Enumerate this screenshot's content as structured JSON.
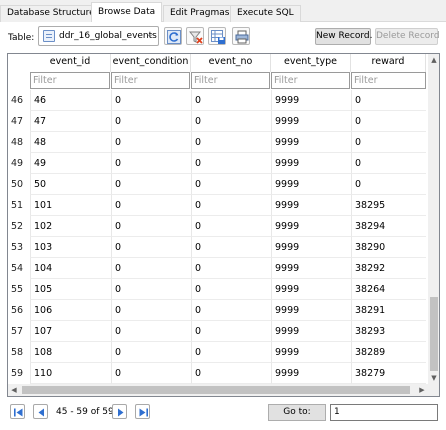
{
  "tabs": [
    {
      "label": "Database Structure",
      "active": false
    },
    {
      "label": "Browse Data",
      "active": true
    },
    {
      "label": "Edit Pragmas",
      "active": false
    },
    {
      "label": "Execute SQL",
      "active": false
    }
  ],
  "toolbar": {
    "table_label": "Table:",
    "table_selected": "ddr_16_global_events",
    "new_record_label": "New Record.",
    "delete_record_label": "Delete Record"
  },
  "grid": {
    "columns": [
      "event_id",
      "event_condition",
      "event_no",
      "event_type",
      "reward"
    ],
    "filter_placeholder": "Filter",
    "rows": [
      {
        "num": "46",
        "cells": [
          "46",
          "0",
          "0",
          "9999",
          "0"
        ]
      },
      {
        "num": "47",
        "cells": [
          "47",
          "0",
          "0",
          "9999",
          "0"
        ]
      },
      {
        "num": "48",
        "cells": [
          "48",
          "0",
          "0",
          "9999",
          "0"
        ]
      },
      {
        "num": "49",
        "cells": [
          "49",
          "0",
          "0",
          "9999",
          "0"
        ]
      },
      {
        "num": "50",
        "cells": [
          "50",
          "0",
          "0",
          "9999",
          "0"
        ]
      },
      {
        "num": "51",
        "cells": [
          "101",
          "0",
          "0",
          "9999",
          "38295"
        ]
      },
      {
        "num": "52",
        "cells": [
          "102",
          "0",
          "0",
          "9999",
          "38294"
        ]
      },
      {
        "num": "53",
        "cells": [
          "103",
          "0",
          "0",
          "9999",
          "38290"
        ]
      },
      {
        "num": "54",
        "cells": [
          "104",
          "0",
          "0",
          "9999",
          "38292"
        ]
      },
      {
        "num": "55",
        "cells": [
          "105",
          "0",
          "0",
          "9999",
          "38264"
        ]
      },
      {
        "num": "56",
        "cells": [
          "106",
          "0",
          "0",
          "9999",
          "38291"
        ]
      },
      {
        "num": "57",
        "cells": [
          "107",
          "0",
          "0",
          "9999",
          "38293"
        ]
      },
      {
        "num": "58",
        "cells": [
          "108",
          "0",
          "0",
          "9999",
          "38289"
        ]
      },
      {
        "num": "59",
        "cells": [
          "110",
          "0",
          "0",
          "9999",
          "38279"
        ]
      }
    ]
  },
  "pagination": {
    "info": "45 - 59 of 59",
    "goto_label": "Go to:",
    "goto_value": "1"
  },
  "icons": {
    "table": "database-table-icon",
    "refresh": "refresh-icon",
    "clear_filters": "clear-filters-icon",
    "save": "save-table-icon",
    "print": "print-icon",
    "first": "first-page-icon",
    "prev": "previous-page-icon",
    "next": "next-page-icon",
    "last": "last-page-icon"
  },
  "colors": {
    "accent": "#2f6fd0",
    "grid_border": "#828790",
    "disabled_text": "#9a9a9a"
  }
}
